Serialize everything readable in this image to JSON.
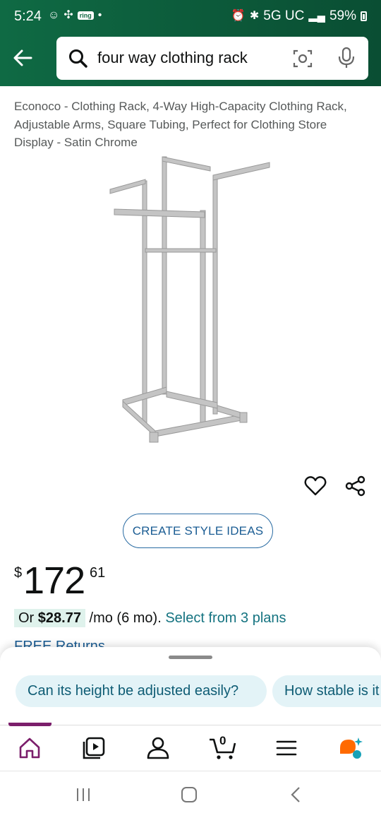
{
  "status_bar": {
    "time": "5:24",
    "ring_label": "ring",
    "network": "5G UC",
    "battery": "59%"
  },
  "search": {
    "query": "four way clothing rack"
  },
  "product": {
    "title": "Econoco - Clothing Rack, 4-Way High-Capacity Clothing Rack, Adjustable Arms, Square Tubing, Perfect for Clothing Store Display - Satin Chrome",
    "style_button_label": "CREATE STYLE IDEAS",
    "price_currency": "$",
    "price_whole": "172",
    "price_fraction": "61",
    "monthly_prefix": "Or ",
    "monthly_amount": "$28.77",
    "monthly_term": "/mo (6 mo).",
    "monthly_link": "Select from 3 plans",
    "free_returns": "FREE Returns"
  },
  "suggestions": [
    "Can its height be adjusted easily?",
    "How stable is it"
  ],
  "bottom_nav": {
    "cart_count": "0"
  },
  "colors": {
    "header_green": "#0f6a44",
    "link_teal": "#147380",
    "nav_active": "#7b1e6b"
  }
}
